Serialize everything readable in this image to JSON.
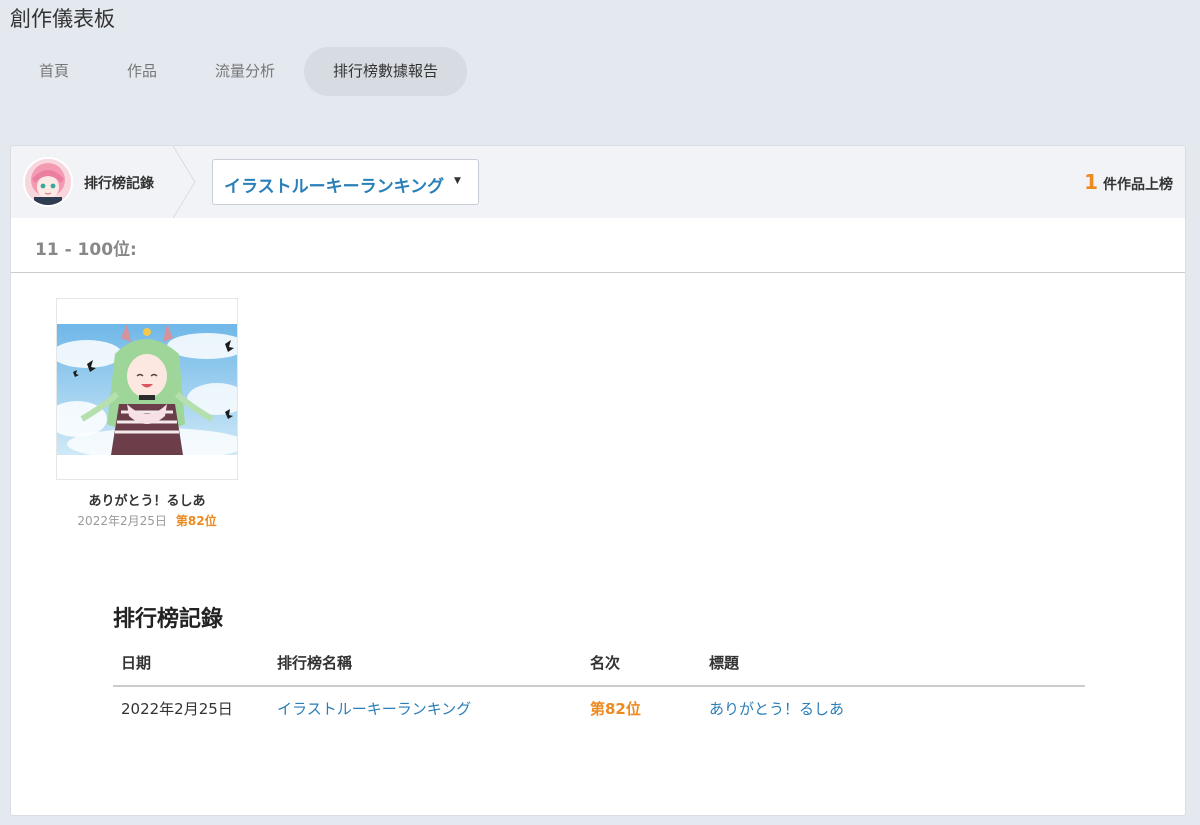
{
  "app": {
    "title": "創作儀表板"
  },
  "nav": {
    "tabs": [
      {
        "label": "首頁",
        "active": false
      },
      {
        "label": "作品",
        "active": false
      },
      {
        "label": "流量分析",
        "active": false
      },
      {
        "label": "排行榜數據報告",
        "active": true
      }
    ]
  },
  "header": {
    "breadcrumb_label": "排行榜記錄",
    "ranking_select": {
      "selected": "イラストルーキーランキング"
    },
    "count": {
      "number": "1",
      "suffix": "件作品上榜"
    }
  },
  "section": {
    "range_label": "11 - 100位:"
  },
  "works": [
    {
      "title": "ありがとう！るしあ",
      "date": "2022年2月25日",
      "rank": "第82位"
    }
  ],
  "records": {
    "title": "排行榜記錄",
    "columns": [
      "日期",
      "排行榜名稱",
      "名次",
      "標題"
    ],
    "rows": [
      {
        "date": "2022年2月25日",
        "ranking": "イラストルーキーランキング",
        "rank": "第82位",
        "title": "ありがとう！るしあ"
      }
    ]
  },
  "colors": {
    "accent_orange": "#ec8a1f",
    "link_blue": "#2a7fb8",
    "page_bg": "#e4e8ef"
  }
}
